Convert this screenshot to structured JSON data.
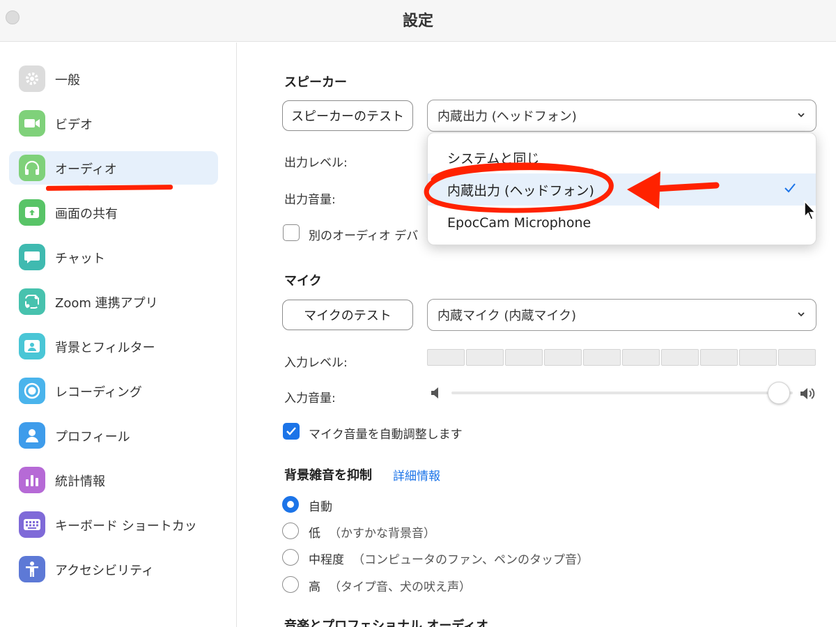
{
  "window": {
    "title": "設定"
  },
  "sidebar": {
    "items": [
      {
        "label": "一般",
        "icon": "gear-icon",
        "color": "#d9d9d9"
      },
      {
        "label": "ビデオ",
        "icon": "video-camera-icon",
        "color": "#7fd17a"
      },
      {
        "label": "オーディオ",
        "icon": "headphones-icon",
        "color": "#7fd17a",
        "active": true
      },
      {
        "label": "画面の共有",
        "icon": "share-screen-icon",
        "color": "#58c467"
      },
      {
        "label": "チャット",
        "icon": "chat-bubble-icon",
        "color": "#3fbab0"
      },
      {
        "label": "Zoom 連携アプリ",
        "icon": "apps-icon",
        "color": "#47c2ae"
      },
      {
        "label": "背景とフィルター",
        "icon": "background-person-icon",
        "color": "#4ac6d6"
      },
      {
        "label": "レコーディング",
        "icon": "record-icon",
        "color": "#4ab4ec"
      },
      {
        "label": "プロフィール",
        "icon": "profile-icon",
        "color": "#3e9ceb"
      },
      {
        "label": "統計情報",
        "icon": "statistics-icon",
        "color": "#b66ad6"
      },
      {
        "label": "キーボード ショートカッ",
        "icon": "keyboard-icon",
        "color": "#7f6ad8"
      },
      {
        "label": "アクセシビリティ",
        "icon": "accessibility-icon",
        "color": "#5d79d6"
      }
    ]
  },
  "speaker": {
    "heading": "スピーカー",
    "test_button": "スピーカーのテスト",
    "device_selected": "内蔵出力 (ヘッドフォン)",
    "output_level_label": "出力レベル:",
    "output_volume_label": "出力音量:",
    "separate_device_label": "別のオーディオ デバ",
    "separate_device_checked": false,
    "dropdown_options": [
      {
        "label": "システムと同じ",
        "selected": false
      },
      {
        "label": "内蔵出力 (ヘッドフォン)",
        "selected": true
      },
      {
        "label": "EpocCam Microphone",
        "selected": false
      }
    ]
  },
  "mic": {
    "heading": "マイク",
    "test_button": "マイクのテスト",
    "device_selected": "内蔵マイク (内蔵マイク)",
    "input_level_label": "入力レベル:",
    "input_volume_label": "入力音量:",
    "input_level_segments": 10,
    "input_volume_fraction": 0.96,
    "auto_adjust_label": "マイク音量を自動調整します",
    "auto_adjust_checked": true
  },
  "noise": {
    "heading": "背景雑音を抑制",
    "details_link": "詳細情報",
    "options": [
      {
        "label": "自動",
        "hint": "",
        "selected": true
      },
      {
        "label": "低",
        "hint": "（かすかな背景音）",
        "selected": false
      },
      {
        "label": "中程度",
        "hint": "（コンピュータのファン、ペンのタップ音）",
        "selected": false
      },
      {
        "label": "高",
        "hint": "（タイプ音、犬の吠え声）",
        "selected": false
      }
    ]
  },
  "music": {
    "heading": "音楽とプロフェショナル オーディオ"
  },
  "colors": {
    "accent": "#1c74e8",
    "annotation": "#ff2200"
  }
}
